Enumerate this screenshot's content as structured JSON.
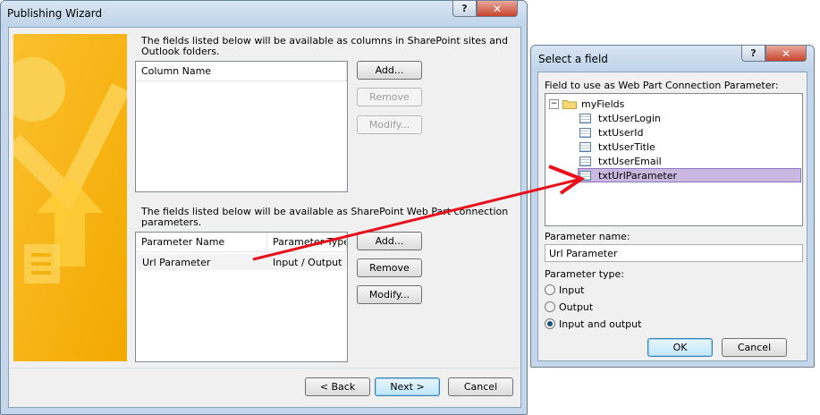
{
  "wizard": {
    "title": "Publishing Wizard",
    "help": "?",
    "close": "✕",
    "columns_intro": "The fields listed below will be available as columns in SharePoint sites and Outlook folders.",
    "columns_intro_line1": "The fields listed below will be available as columns in SharePoint sites and",
    "columns_intro_line2": "Outlook folders.",
    "column_header": "Column Name",
    "params_intro_line1": "The fields listed below will be available as SharePoint Web Part connection",
    "params_intro_line2": "parameters.",
    "param_headers": [
      "Parameter Name",
      "Parameter Type"
    ],
    "param_rows": [
      {
        "name": "Url Parameter",
        "type": "Input / Output"
      }
    ],
    "col_buttons": {
      "add": "Add...",
      "remove": "Remove",
      "modify": "Modify..."
    },
    "param_buttons": {
      "add": "Add...",
      "remove": "Remove",
      "modify": "Modify..."
    },
    "nav": {
      "back": "< Back",
      "next": "Next >",
      "cancel": "Cancel"
    }
  },
  "field_dialog": {
    "title": "Select a field",
    "help": "?",
    "close": "✕",
    "tree_label": "Field to use as Web Part Connection Parameter:",
    "root": "myFields",
    "root_toggle": "−",
    "fields": [
      "txtUserLogin",
      "txtUserId",
      "txtUserTitle",
      "txtUserEmail",
      "txtUrlParameter"
    ],
    "selected_field": "txtUrlParameter",
    "param_name_label": "Parameter name:",
    "param_name_value": "Url Parameter",
    "param_type_label": "Parameter type:",
    "types": [
      "Input",
      "Output",
      "Input and output"
    ],
    "selected_type": "Input and output",
    "ok": "OK",
    "cancel": "Cancel"
  },
  "colors": {
    "arrow": "#e8101b",
    "selection": "#c9b8e0",
    "banner": "#f5b800"
  }
}
